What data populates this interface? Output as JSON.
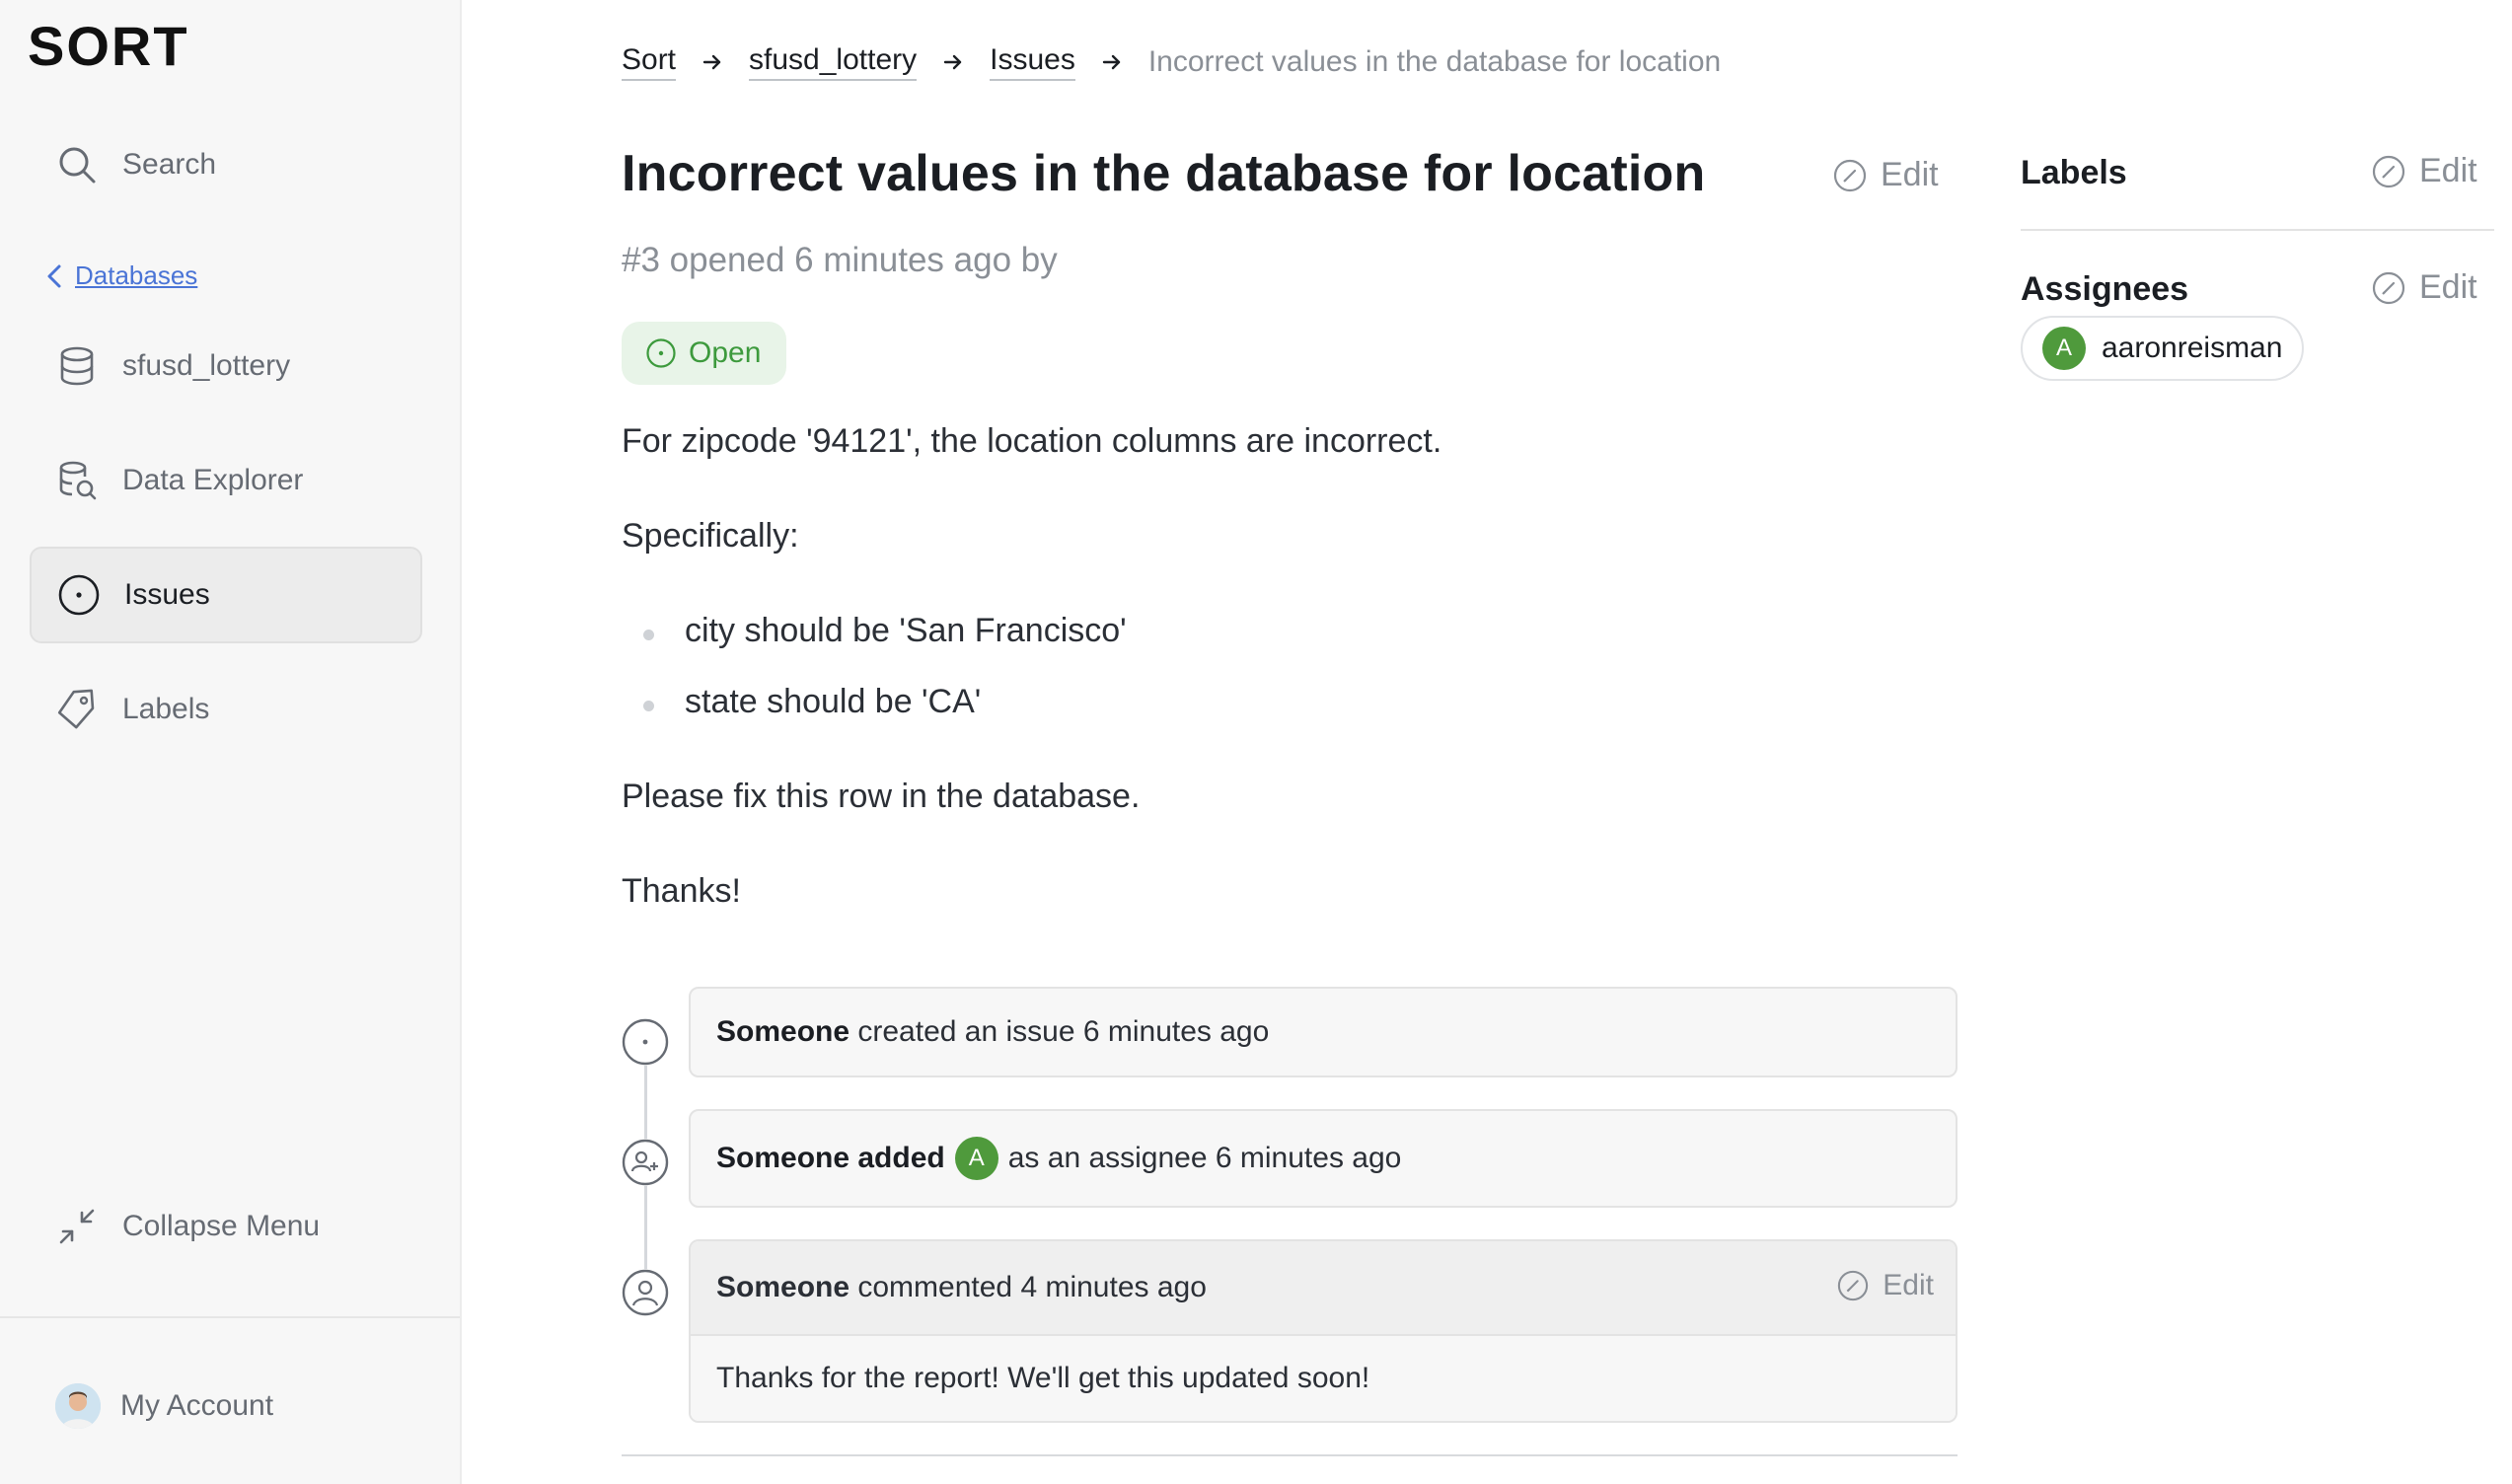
{
  "app": {
    "logo_text": "SORT"
  },
  "sidebar": {
    "search_label": "Search",
    "back_label": "Databases",
    "items": [
      {
        "label": "sfusd_lottery",
        "icon": "database-icon"
      },
      {
        "label": "Data Explorer",
        "icon": "data-explorer-icon"
      },
      {
        "label": "Issues",
        "icon": "issue-icon",
        "active": true
      },
      {
        "label": "Labels",
        "icon": "tag-icon"
      }
    ],
    "collapse_label": "Collapse Menu",
    "account_label": "My Account"
  },
  "breadcrumb": {
    "items": [
      "Sort",
      "sfusd_lottery",
      "Issues"
    ],
    "current": "Incorrect values in the database for location"
  },
  "issue": {
    "title": "Incorrect values in the database for location",
    "edit_label": "Edit",
    "meta": "#3 opened 6 minutes ago by",
    "status": "Open",
    "body": {
      "p1": "For zipcode '94121', the location columns are incorrect.",
      "p2": "Specifically:",
      "bullets": [
        "city should be 'San Francisco'",
        "state should be 'CA'"
      ],
      "p3": "Please fix this row in the database.",
      "p4": "Thanks!"
    }
  },
  "timeline": {
    "events": [
      {
        "actor": "Someone",
        "text": "created an issue 6 minutes ago"
      },
      {
        "actor": "Someone",
        "text_before": "added",
        "avatar_letter": "A",
        "text_after": "as an assignee 6 minutes ago"
      },
      {
        "actor": "Someone",
        "text": "commented 4 minutes ago",
        "edit_label": "Edit",
        "comment": "Thanks for the report! We'll get this updated soon!"
      }
    ]
  },
  "right_panel": {
    "labels_heading": "Labels",
    "labels_edit": "Edit",
    "assignees_heading": "Assignees",
    "assignees_edit": "Edit",
    "assignee": {
      "initial": "A",
      "name": "aaronreisman"
    }
  },
  "colors": {
    "accent_link": "#4a74d6",
    "status_open": "#3d9a3d",
    "avatar_green": "#4f9a3c"
  }
}
